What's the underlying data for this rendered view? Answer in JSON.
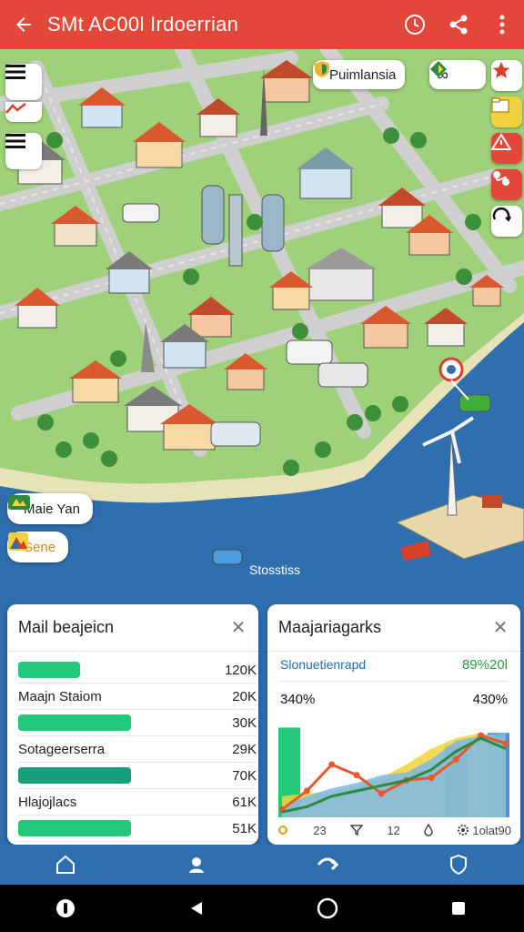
{
  "appbar": {
    "title": "SMt AC00l Irdoerrian"
  },
  "map": {
    "chip_top": "Puimlansia",
    "chip_badge": "∞",
    "chip_place": "Maie Yan",
    "chip_scene": "Sene",
    "water_label": "Stosstiss"
  },
  "left_card": {
    "title": "Mail beajeicn",
    "rows": [
      {
        "label": "",
        "value": "120K",
        "bar": 0.33,
        "color": "#22c97a"
      },
      {
        "label": "Maajn Staiom",
        "value": "20K",
        "bar": 0,
        "color": "#22c97a"
      },
      {
        "label": "",
        "value": "30K",
        "bar": 0.6,
        "color": "#22c97a"
      },
      {
        "label": "Sotageerserra",
        "value": "29K",
        "bar": 0,
        "color": "#22c97a"
      },
      {
        "label": "",
        "value": "70K",
        "bar": 0.6,
        "color": "#169e7a"
      },
      {
        "label": "Hlajojlacs",
        "value": "61K",
        "bar": 0,
        "color": "#22c97a"
      },
      {
        "label": "",
        "value": "51K",
        "bar": 0.6,
        "color": "#22c97a"
      }
    ]
  },
  "right_card": {
    "title": "Maajariagarks",
    "subtitle": "Slonuetienrapd",
    "stat": "89%20l",
    "left_value": "340%",
    "right_value": "430%",
    "footer": [
      "23",
      "12",
      "1olat90"
    ]
  },
  "chart_data": {
    "type": "area",
    "categories": [
      "1",
      "2",
      "3",
      "4",
      "5",
      "6",
      "7",
      "8",
      "9",
      "10"
    ],
    "series": [
      {
        "values": [
          0.8,
          0.9,
          1.0,
          1.2,
          1.5,
          2.0,
          2.6,
          3.0,
          3.2,
          3.0
        ],
        "color": "#f2d23a"
      },
      {
        "values": [
          0.4,
          0.8,
          1.1,
          1.3,
          1.6,
          1.7,
          2.2,
          2.9,
          3.1,
          3.2
        ],
        "color": "#7ab8e8"
      },
      {
        "values": [
          0.3,
          1.0,
          2.0,
          1.6,
          0.9,
          1.4,
          1.5,
          2.2,
          3.1,
          2.8
        ],
        "color": "#e8582e"
      },
      {
        "values": [
          0.2,
          0.4,
          0.8,
          1.0,
          1.2,
          1.4,
          1.8,
          2.5,
          3.0,
          2.6
        ],
        "color": "#2b8a3e"
      }
    ],
    "bars": [
      {
        "index": 0,
        "value": 3.4,
        "color": "#22c97a"
      },
      {
        "index": 7,
        "value": 2.7,
        "color": "#1f4f9c"
      },
      {
        "index": 9,
        "value": 3.2,
        "color": "#4a8fd8"
      }
    ],
    "ylim": [
      0,
      4
    ]
  },
  "colors": {
    "appbar": "#e2473a",
    "land": "#9fd07a",
    "water": "#2f6fb0",
    "road": "#c9c9c9"
  },
  "icons": {
    "appbar": [
      "back-arrow-icon",
      "clock-icon",
      "share-icon",
      "more-vert-icon"
    ],
    "side": [
      "star-icon",
      "folder-icon",
      "warning-icon",
      "route-icon",
      "refresh-icon"
    ],
    "nav": [
      "home-icon",
      "profile-icon",
      "share-icon",
      "shield-icon"
    ]
  }
}
